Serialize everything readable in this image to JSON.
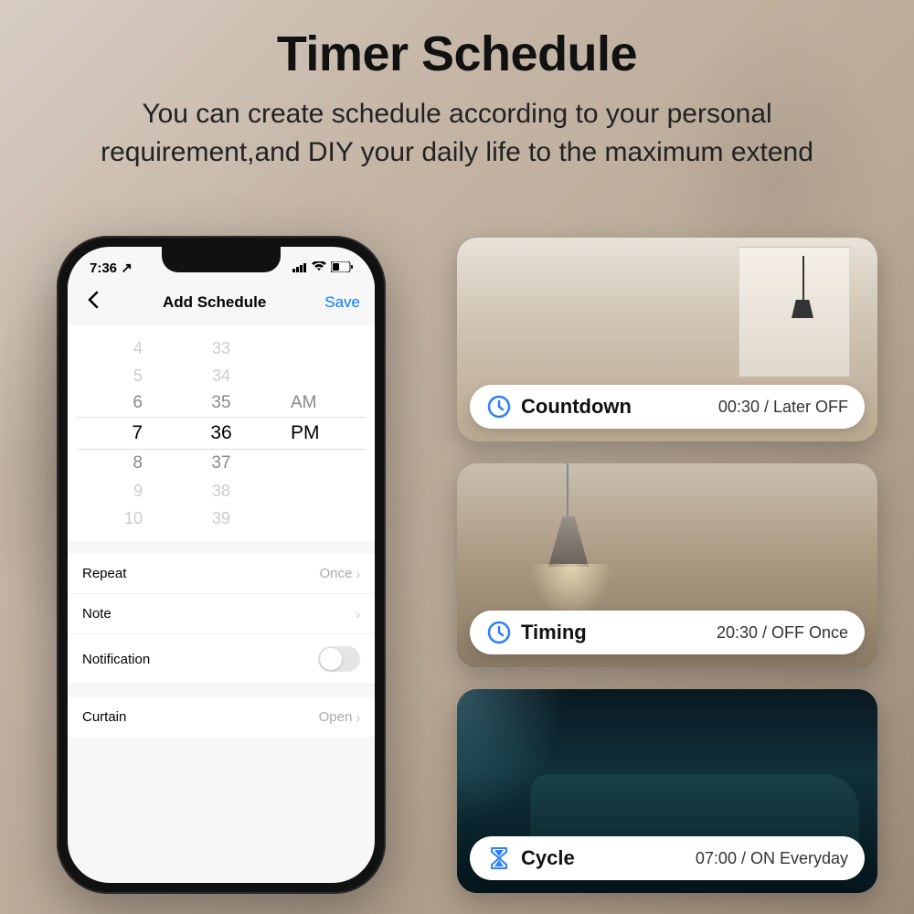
{
  "header": {
    "title": "Timer Schedule",
    "subtitle": "You can create schedule according to your personal requirement,and DIY your daily life to the maximum extend"
  },
  "phone": {
    "status": {
      "time": "7:36",
      "nav_icon": "◀"
    },
    "nav": {
      "title": "Add Schedule",
      "save": "Save"
    },
    "picker": {
      "rows": [
        {
          "h": "4",
          "m": "33",
          "a": ""
        },
        {
          "h": "5",
          "m": "34",
          "a": ""
        },
        {
          "h": "6",
          "m": "35",
          "a": "AM"
        },
        {
          "h": "7",
          "m": "36",
          "a": "PM"
        },
        {
          "h": "8",
          "m": "37",
          "a": ""
        },
        {
          "h": "9",
          "m": "38",
          "a": ""
        },
        {
          "h": "10",
          "m": "39",
          "a": ""
        }
      ]
    },
    "rows": {
      "repeat": {
        "label": "Repeat",
        "value": "Once"
      },
      "note": {
        "label": "Note",
        "value": ""
      },
      "notification": {
        "label": "Notification"
      },
      "curtain": {
        "label": "Curtain",
        "value": "Open"
      }
    }
  },
  "cards": [
    {
      "title": "Countdown",
      "value": "00:30 / Later OFF",
      "icon": "clock"
    },
    {
      "title": "Timing",
      "value": "20:30 / OFF Once",
      "icon": "clock"
    },
    {
      "title": "Cycle",
      "value": "07:00 / ON Everyday",
      "icon": "hourglass"
    }
  ]
}
